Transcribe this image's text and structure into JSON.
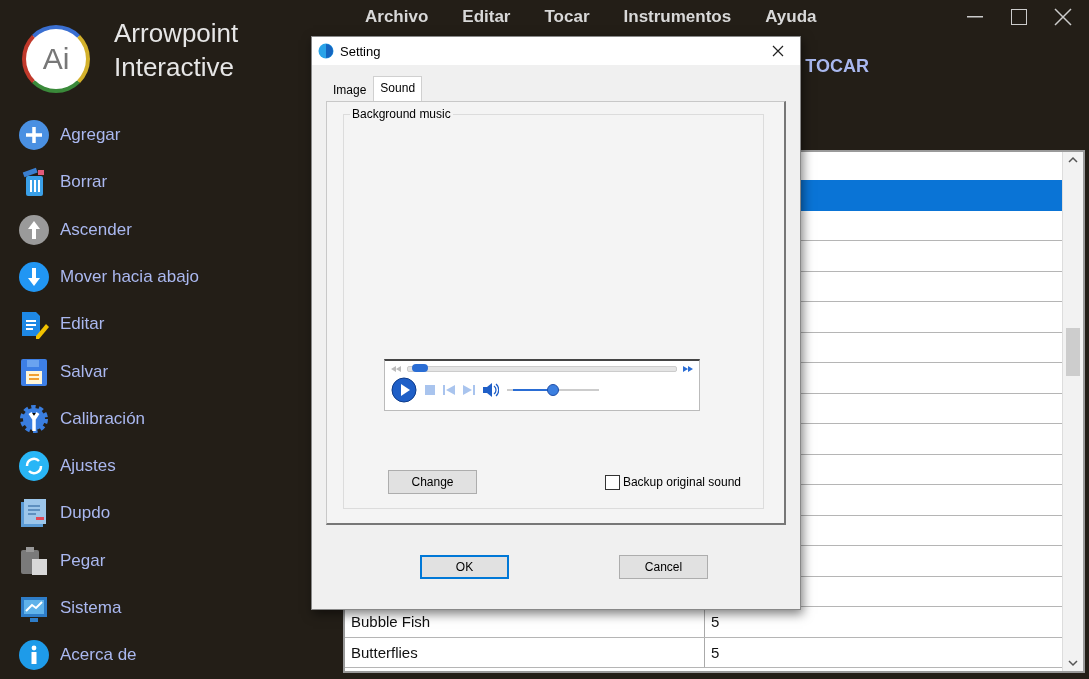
{
  "app": {
    "logo": "Ai",
    "title": "Arrowpoint Interactive"
  },
  "sidebar": {
    "items": [
      {
        "label": "Agregar"
      },
      {
        "label": "Borrar"
      },
      {
        "label": "Ascender"
      },
      {
        "label": "Mover hacia abajo"
      },
      {
        "label": "Editar"
      },
      {
        "label": "Salvar"
      },
      {
        "label": "Calibración"
      },
      {
        "label": "Ajustes"
      },
      {
        "label": "Dupdo"
      },
      {
        "label": "Pegar"
      },
      {
        "label": "Sistema"
      },
      {
        "label": "Acerca de"
      }
    ]
  },
  "menu": [
    "Archivo",
    "Editar",
    "Tocar",
    "Instrumentos",
    "Ayuda"
  ],
  "heading": "TOCAR",
  "table": {
    "rows": [
      {
        "selected": true
      },
      {
        "selected": false
      },
      {
        "selected": false
      },
      {
        "selected": false
      },
      {
        "selected": false
      },
      {
        "selected": false
      },
      {
        "selected": false
      },
      {
        "selected": false
      },
      {
        "selected": false
      },
      {
        "selected": false
      },
      {
        "selected": false
      },
      {
        "selected": false
      },
      {
        "selected": false
      },
      {
        "selected": false
      },
      {
        "selected": false,
        "name": "Bubble Fish",
        "value": "5"
      },
      {
        "selected": false,
        "name": "Butterflies",
        "value": "5"
      }
    ]
  },
  "dialog": {
    "title": "Setting",
    "tabs": [
      {
        "label": "Image",
        "selected": false
      },
      {
        "label": "Sound",
        "selected": true
      }
    ],
    "group": "Background music",
    "player": {
      "seek": {
        "level": 0.03
      },
      "volume": {
        "level": 0.5
      }
    },
    "change_button": "Change",
    "backup": {
      "label": "Backup original sound",
      "checked": false
    },
    "buttons": [
      {
        "label": "OK",
        "default": true
      },
      {
        "label": "Cancel",
        "default": false
      }
    ]
  }
}
